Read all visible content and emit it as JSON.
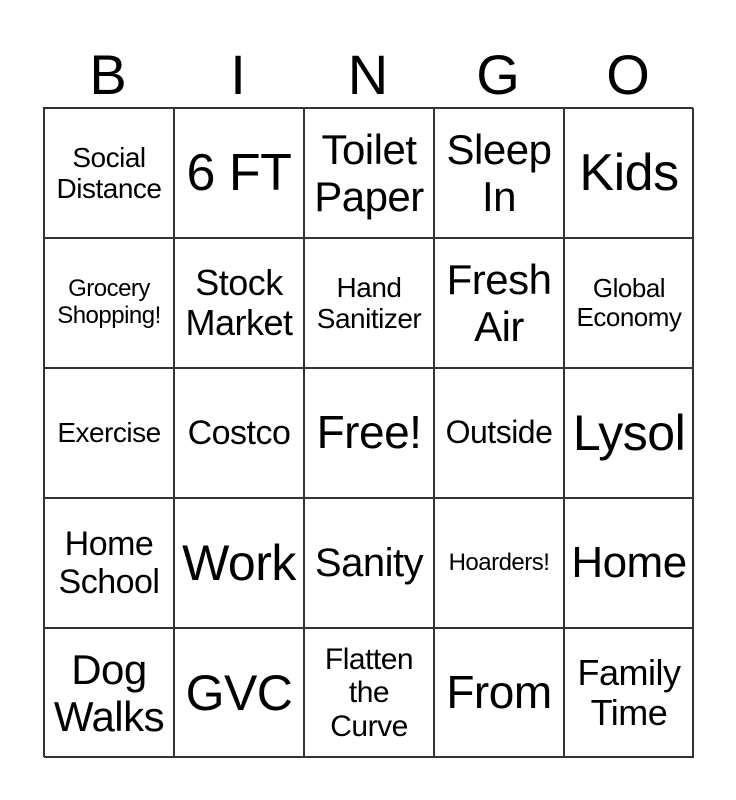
{
  "header": {
    "letters": [
      "B",
      "I",
      "N",
      "G",
      "O"
    ]
  },
  "grid": {
    "rows": [
      [
        {
          "text": "Social\nDistance",
          "size": 28
        },
        {
          "text": "6 FT",
          "size": 52
        },
        {
          "text": "Toilet\nPaper",
          "size": 42
        },
        {
          "text": "Sleep\nIn",
          "size": 42
        },
        {
          "text": "Kids",
          "size": 52
        }
      ],
      [
        {
          "text": "Grocery\nShopping!",
          "size": 24
        },
        {
          "text": "Stock\nMarket",
          "size": 36
        },
        {
          "text": "Hand\nSanitizer",
          "size": 28
        },
        {
          "text": "Fresh\nAir",
          "size": 42
        },
        {
          "text": "Global\nEconomy",
          "size": 26
        }
      ],
      [
        {
          "text": "Exercise",
          "size": 28
        },
        {
          "text": "Costco",
          "size": 34
        },
        {
          "text": "Free!",
          "size": 46
        },
        {
          "text": "Outside",
          "size": 32
        },
        {
          "text": "Lysol",
          "size": 50
        }
      ],
      [
        {
          "text": "Home\nSchool",
          "size": 34
        },
        {
          "text": "Work",
          "size": 50
        },
        {
          "text": "Sanity",
          "size": 40
        },
        {
          "text": "Hoarders!",
          "size": 24
        },
        {
          "text": "Home",
          "size": 44
        }
      ],
      [
        {
          "text": "Dog\nWalks",
          "size": 42
        },
        {
          "text": "GVC",
          "size": 50
        },
        {
          "text": "Flatten\nthe\nCurve",
          "size": 30
        },
        {
          "text": "From",
          "size": 46
        },
        {
          "text": "Family\nTime",
          "size": 36
        }
      ]
    ]
  }
}
